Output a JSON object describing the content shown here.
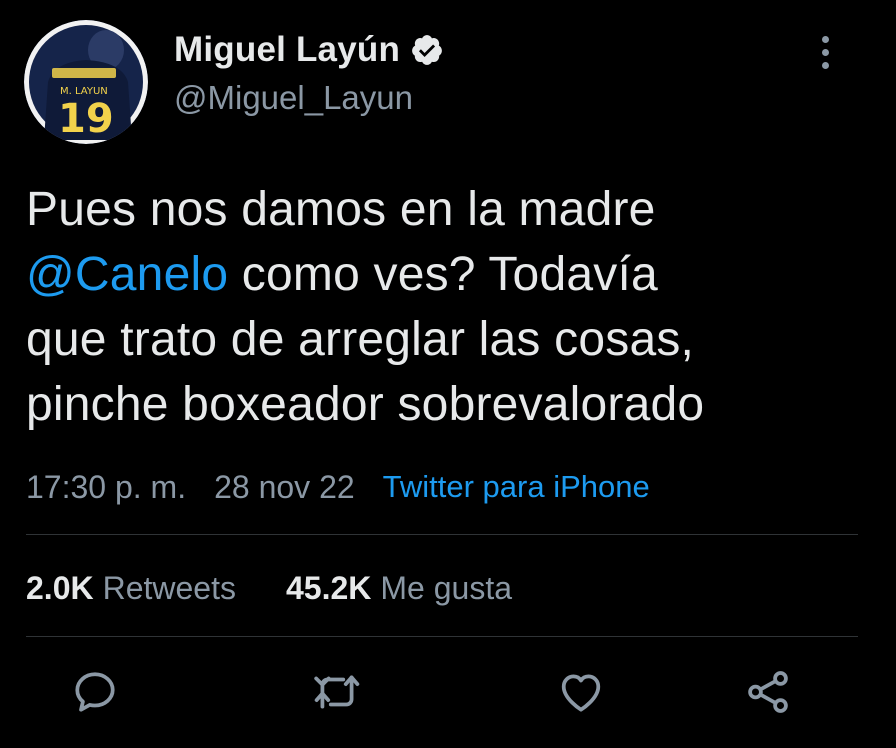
{
  "author": {
    "display_name": "Miguel Layún",
    "handle": "@Miguel_Layun",
    "avatar_jersey_name": "M. LAYUN",
    "avatar_jersey_number": "19",
    "verified_icon": "verified-badge-icon"
  },
  "tweet": {
    "lines": [
      {
        "parts": [
          {
            "text": "Pues nos damos en la madre",
            "type": "text"
          }
        ]
      },
      {
        "parts": [
          {
            "text": "@Canelo",
            "type": "mention"
          },
          {
            "text": " como ves? Todavía",
            "type": "text"
          }
        ]
      },
      {
        "parts": [
          {
            "text": "que trato de arreglar las cosas,",
            "type": "text"
          }
        ]
      },
      {
        "parts": [
          {
            "text": "pinche boxeador sobrevalorado",
            "type": "text"
          }
        ]
      }
    ]
  },
  "meta": {
    "time": "17:30 p. m.",
    "date": "28 nov 22",
    "source": "Twitter para iPhone"
  },
  "stats": {
    "retweets_count": "2.0K",
    "retweets_label": "Retweets",
    "likes_count": "45.2K",
    "likes_label": "Me gusta"
  },
  "actions": [
    "reply-icon",
    "retweet-icon",
    "like-icon",
    "share-icon"
  ],
  "colors": {
    "background": "#000000",
    "text": "#e7e9ea",
    "secondary": "#8b98a5",
    "accent": "#1d9bf0",
    "divider": "#2f3336"
  }
}
